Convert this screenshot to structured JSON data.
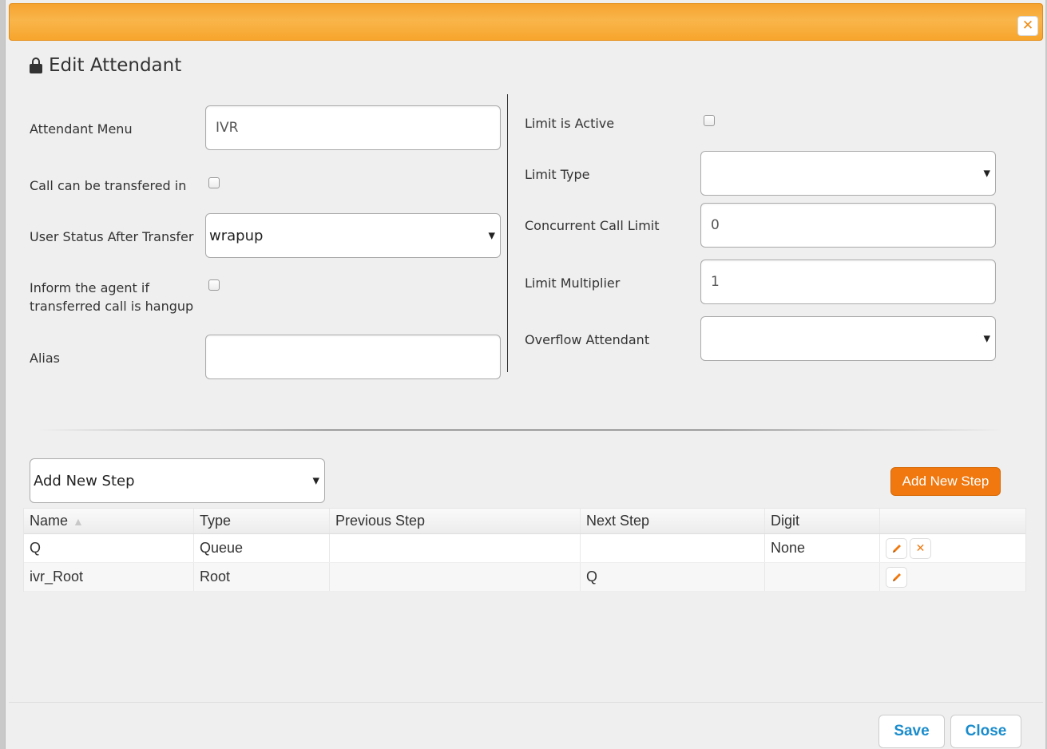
{
  "header": {
    "title": "Edit Attendant"
  },
  "left_form": {
    "attendant_menu": {
      "label": "Attendant Menu",
      "value": "IVR"
    },
    "call_transfer": {
      "label": "Call can be transfered in"
    },
    "user_status": {
      "label": "User Status After Transfer",
      "value": "wrapup"
    },
    "inform_agent": {
      "label_line1": "Inform the agent if",
      "label_line2": "transferred call is hangup"
    },
    "alias": {
      "label": "Alias",
      "value": ""
    }
  },
  "right_form": {
    "limit_active": {
      "label": "Limit is Active"
    },
    "limit_type": {
      "label": "Limit Type",
      "value": ""
    },
    "concurrent_limit": {
      "label": "Concurrent Call Limit",
      "value": "0"
    },
    "limit_multiplier": {
      "label": "Limit Multiplier",
      "value": "1"
    },
    "overflow_attendant": {
      "label": "Overflow Attendant",
      "value": ""
    }
  },
  "steps": {
    "select_value": "Add New Step",
    "add_button": "Add New Step"
  },
  "table": {
    "columns": [
      "Name",
      "Type",
      "Previous Step",
      "Next Step",
      "Digit"
    ],
    "rows": [
      {
        "name": "Q",
        "type": "Queue",
        "previous": "",
        "next": "",
        "digit": "None"
      },
      {
        "name": "ivr_Root",
        "type": "Root",
        "previous": "",
        "next": "Q",
        "digit": ""
      }
    ]
  },
  "footer": {
    "save": "Save",
    "close": "Close"
  },
  "colors": {
    "accent": "#f0780f",
    "titlebar": "#f7a52c",
    "link": "#1a8ccc"
  },
  "icons": {
    "close": "close-icon",
    "lock": "lock-icon",
    "edit": "pencil-icon",
    "delete": "delete-x-icon"
  }
}
